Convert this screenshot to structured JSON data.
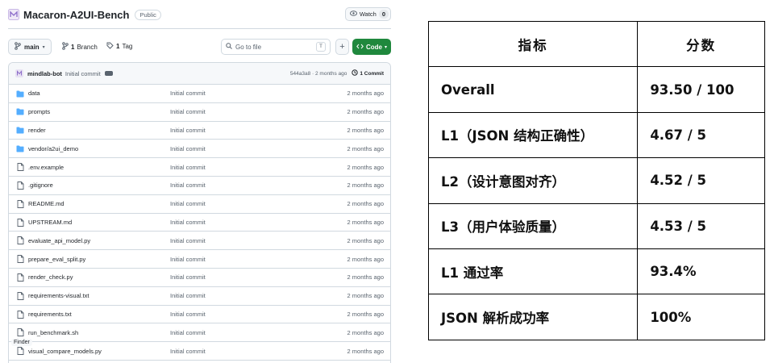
{
  "repo": {
    "name": "Macaron-A2UI-Bench",
    "visibility": "Public",
    "watch_label": "Watch",
    "watch_count": "0",
    "accent_color": "#1f883d"
  },
  "toolbar": {
    "branch": "main",
    "branch_count": "1",
    "branch_label": "Branch",
    "tag_count": "1",
    "tag_label": "Tag",
    "search_placeholder": "Go to file",
    "search_shortcut": "T",
    "add_label": "+",
    "code_label": "Code"
  },
  "commit": {
    "author": "mindlab-bot",
    "message": "Initial commit",
    "hash_time": "544a3a8 · 2 months ago",
    "commit_count": "1 Commit"
  },
  "files": [
    {
      "name": "data",
      "type": "folder",
      "commit": "Initial commit",
      "age": "2 months ago"
    },
    {
      "name": "prompts",
      "type": "folder",
      "commit": "Initial commit",
      "age": "2 months ago"
    },
    {
      "name": "render",
      "type": "folder",
      "commit": "Initial commit",
      "age": "2 months ago"
    },
    {
      "name": "vendor/a2ui_demo",
      "type": "folder",
      "commit": "Initial commit",
      "age": "2 months ago"
    },
    {
      "name": ".env.example",
      "type": "file",
      "commit": "Initial commit",
      "age": "2 months ago"
    },
    {
      "name": ".gitignore",
      "type": "file",
      "commit": "Initial commit",
      "age": "2 months ago"
    },
    {
      "name": "README.md",
      "type": "file",
      "commit": "Initial commit",
      "age": "2 months ago"
    },
    {
      "name": "UPSTREAM.md",
      "type": "file",
      "commit": "Initial commit",
      "age": "2 months ago"
    },
    {
      "name": "evaluate_api_model.py",
      "type": "file",
      "commit": "Initial commit",
      "age": "2 months ago"
    },
    {
      "name": "prepare_eval_split.py",
      "type": "file",
      "commit": "Initial commit",
      "age": "2 months ago"
    },
    {
      "name": "render_check.py",
      "type": "file",
      "commit": "Initial commit",
      "age": "2 months ago"
    },
    {
      "name": "requirements-visual.txt",
      "type": "file",
      "commit": "Initial commit",
      "age": "2 months ago"
    },
    {
      "name": "requirements.txt",
      "type": "file",
      "commit": "Initial commit",
      "age": "2 months ago"
    },
    {
      "name": "run_benchmark.sh",
      "type": "file",
      "commit": "Initial commit",
      "age": "2 months ago"
    },
    {
      "name": "visual_compare_models.py",
      "type": "file",
      "commit": "Initial commit",
      "age": "2 months ago"
    }
  ],
  "tooltip": "Finder",
  "score_table": {
    "headers": [
      "指标",
      "分数"
    ],
    "rows": [
      [
        "Overall",
        "93.50 / 100"
      ],
      [
        "L1（JSON 结构正确性）",
        "4.67 / 5"
      ],
      [
        "L2（设计意图对齐）",
        "4.52 / 5"
      ],
      [
        "L3（用户体验质量）",
        "4.53 / 5"
      ],
      [
        "L1 通过率",
        "93.4%"
      ],
      [
        "JSON 解析成功率",
        "100%"
      ]
    ]
  }
}
